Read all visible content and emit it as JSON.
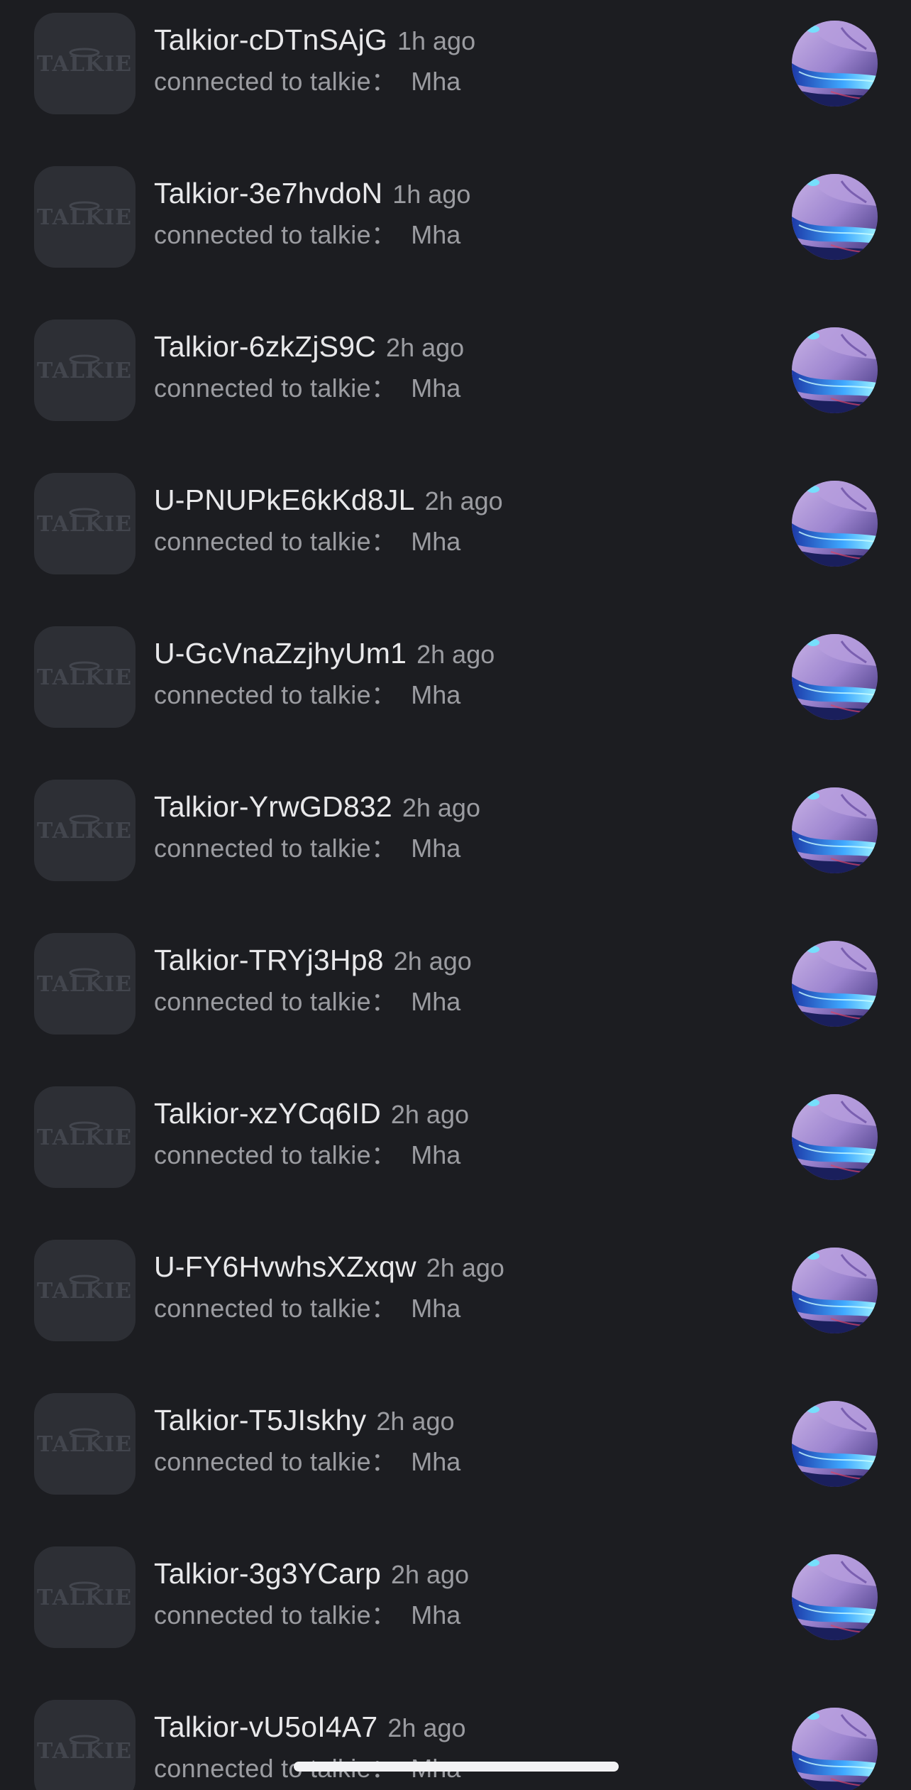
{
  "notifications": [
    {
      "name": "Talkior-cDTnSAjG",
      "time": "1h ago",
      "prefix": "connected to talkie：",
      "user": "Mha"
    },
    {
      "name": "Talkior-3e7hvdoN",
      "time": "1h ago",
      "prefix": "connected to talkie：",
      "user": "Mha"
    },
    {
      "name": "Talkior-6zkZjS9C",
      "time": "2h ago",
      "prefix": "connected to talkie：",
      "user": "Mha"
    },
    {
      "name": "U-PNUPkE6kKd8JL",
      "time": "2h ago",
      "prefix": "connected to talkie：",
      "user": "Mha"
    },
    {
      "name": "U-GcVnaZzjhyUm1",
      "time": "2h ago",
      "prefix": "connected to talkie：",
      "user": "Mha"
    },
    {
      "name": "Talkior-YrwGD832",
      "time": "2h ago",
      "prefix": "connected to talkie：",
      "user": "Mha"
    },
    {
      "name": "Talkior-TRYj3Hp8",
      "time": "2h ago",
      "prefix": "connected to talkie：",
      "user": "Mha"
    },
    {
      "name": "Talkior-xzYCq6ID",
      "time": "2h ago",
      "prefix": "connected to talkie：",
      "user": "Mha"
    },
    {
      "name": "U-FY6HvwhsXZxqw",
      "time": "2h ago",
      "prefix": "connected to talkie：",
      "user": "Mha"
    },
    {
      "name": "Talkior-T5JIskhy",
      "time": "2h ago",
      "prefix": "connected to talkie：",
      "user": "Mha"
    },
    {
      "name": "Talkior-3g3YCarp",
      "time": "2h ago",
      "prefix": "connected to talkie：",
      "user": "Mha"
    },
    {
      "name": "Talkior-vU5oI4A7",
      "time": "2h ago",
      "prefix": "connected to talkie：",
      "user": "Mha"
    }
  ],
  "logo": {
    "text": "TALKIE",
    "icon": "talkie-logo-icon"
  },
  "avatar": {
    "icon": "character-avatar"
  },
  "colors": {
    "background": "#1c1d21",
    "logo_tile": "#2d2f35",
    "name_text": "#e8e8ea",
    "secondary_text": "#9b9ca1",
    "avatar_base": "#2a2450",
    "avatar_glow": "#5ad8ff"
  }
}
